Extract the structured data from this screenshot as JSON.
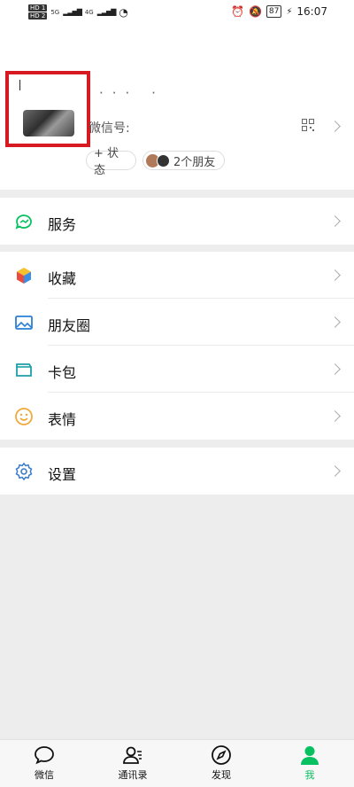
{
  "status_bar": {
    "time": "16:07",
    "battery": "87",
    "network": "4G",
    "hd1": "HD 1",
    "hd2": "HD 2",
    "signal": "5G"
  },
  "profile": {
    "nickname": "··· ·",
    "wechat_id_label": "微信号:",
    "status_button": "+ 状态",
    "friends_chip": "2个朋友"
  },
  "menu": {
    "services": "服务",
    "favorites": "收藏",
    "moments": "朋友圈",
    "cards": "卡包",
    "stickers": "表情",
    "settings": "设置"
  },
  "tabs": [
    {
      "label": "微信",
      "icon": "chat-bubble-icon"
    },
    {
      "label": "通讯录",
      "icon": "contacts-icon"
    },
    {
      "label": "发现",
      "icon": "compass-icon"
    },
    {
      "label": "我",
      "icon": "person-icon"
    }
  ],
  "colors": {
    "accent": "#07c160",
    "highlight_box": "#d71921",
    "background": "#ededed"
  }
}
